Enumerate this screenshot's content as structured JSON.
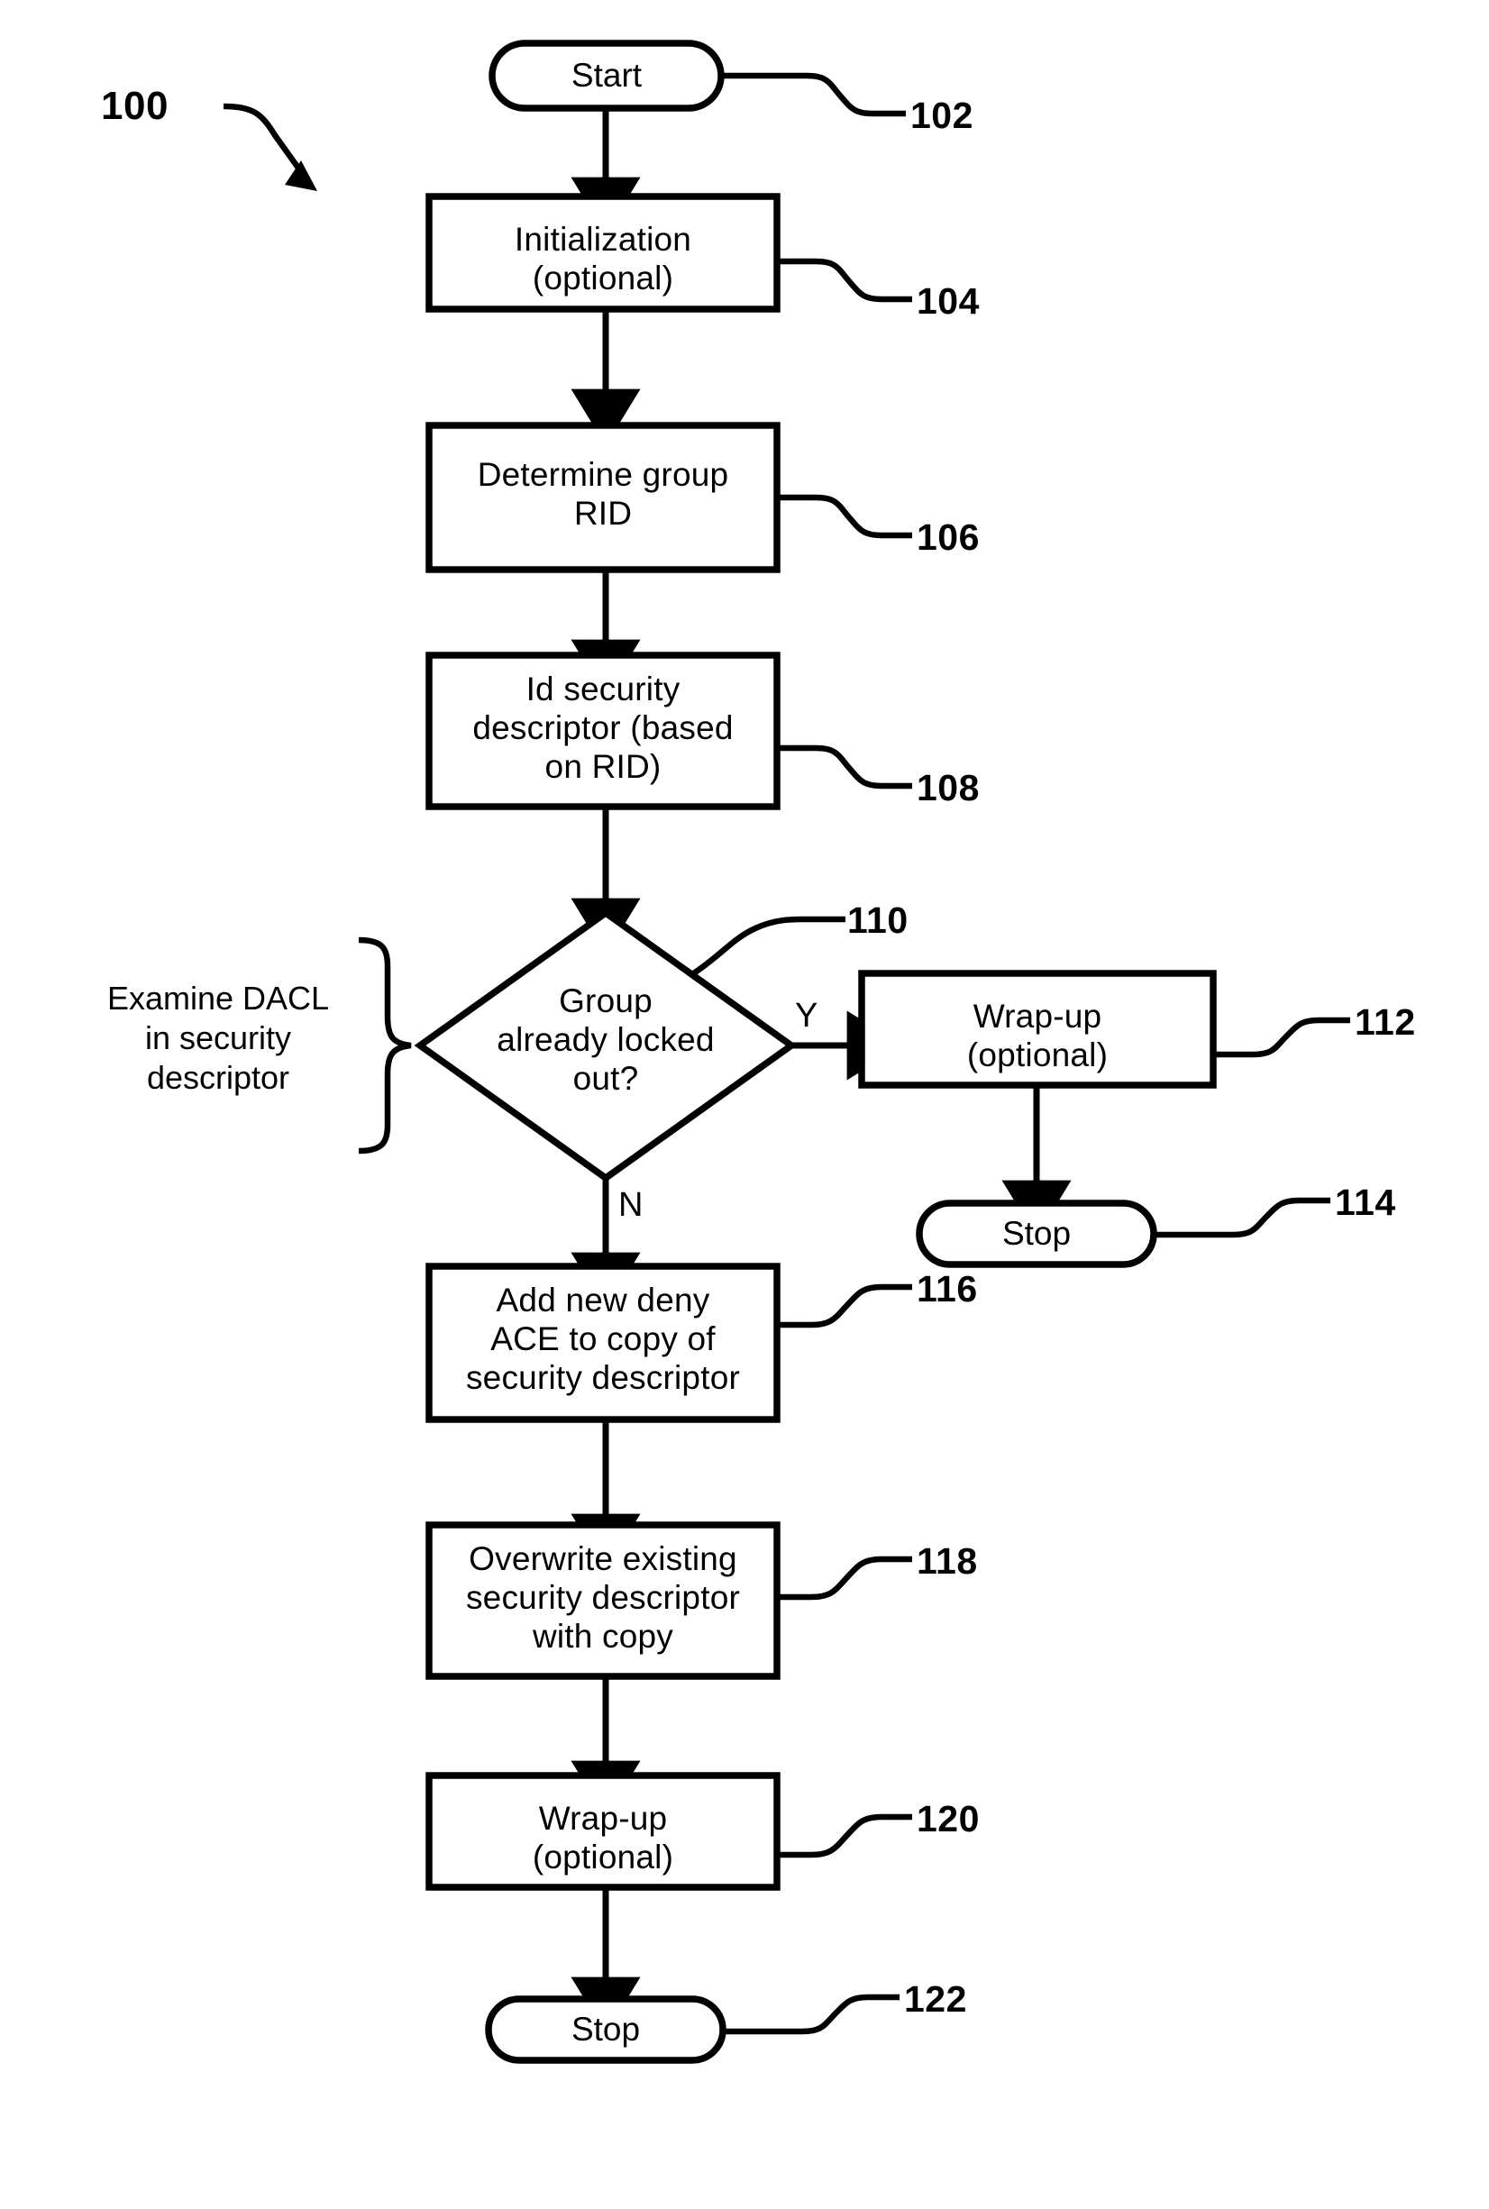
{
  "figure": {
    "id_label": "100",
    "type": "flowchart"
  },
  "nodes": {
    "start": {
      "label": "Start",
      "ref": "102",
      "shape": "terminator"
    },
    "initialization": {
      "label": "Initialization\n(optional)",
      "ref": "104",
      "shape": "process"
    },
    "determine_rid": {
      "label": "Determine group\nRID",
      "ref": "106",
      "shape": "process"
    },
    "id_descriptor": {
      "label": "Id security\ndescriptor (based\non RID)",
      "ref": "108",
      "shape": "process"
    },
    "decision": {
      "label": "Group\nalready locked\nout?",
      "ref": "110",
      "shape": "decision"
    },
    "wrapup_yes": {
      "label": "Wrap-up\n(optional)",
      "ref": "112",
      "shape": "process"
    },
    "stop_yes": {
      "label": "Stop",
      "ref": "114",
      "shape": "terminator"
    },
    "add_ace": {
      "label": "Add new deny\nACE to copy of\nsecurity descriptor",
      "ref": "116",
      "shape": "process"
    },
    "overwrite": {
      "label": "Overwrite existing\nsecurity descriptor\nwith copy",
      "ref": "118",
      "shape": "process"
    },
    "wrapup_no": {
      "label": "Wrap-up\n(optional)",
      "ref": "120",
      "shape": "process"
    },
    "stop_no": {
      "label": "Stop",
      "ref": "122",
      "shape": "terminator"
    }
  },
  "branch_labels": {
    "yes": "Y",
    "no": "N"
  },
  "annotation": {
    "text": "Examine DACL\nin security\ndescriptor"
  },
  "colors": {
    "ink": "#000000",
    "paper": "#ffffff"
  }
}
